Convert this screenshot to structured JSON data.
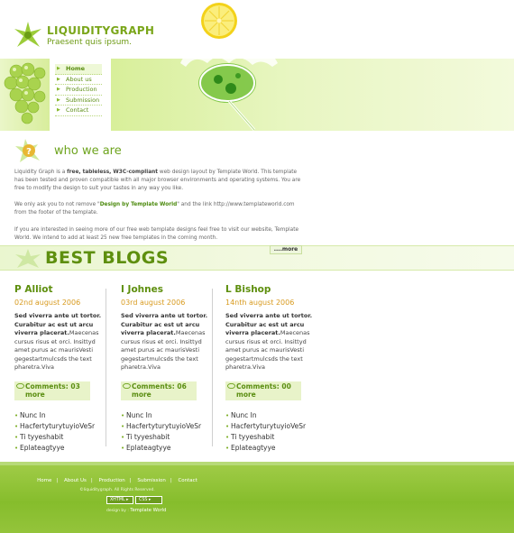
{
  "logo": {
    "name": "LIQUIDITYGRAPH",
    "tagline": "Praesent quis ipsum."
  },
  "nav": [
    {
      "label": "Home",
      "active": true
    },
    {
      "label": "About us",
      "active": false
    },
    {
      "label": "Production",
      "active": false
    },
    {
      "label": "Submission",
      "active": false
    },
    {
      "label": "Contact",
      "active": false
    }
  ],
  "who": {
    "title": "who we are",
    "p1_pre": "Liquidity Graph is a ",
    "p1_bold": "free, tableless, W3C-compliant",
    "p1_post": " web design layout by Template World. This template has been tested and proven compatible with all major browser environments and operating systems. You are free to modify the design to suit your tastes in any way you like.",
    "p2_pre": "We only ask you to not remove \"",
    "p2_link": "Design by Template World",
    "p2_post": "\" and the link http://www.templateworld.com from the footer of the template.",
    "p3": "If you are interested in seeing more of our free web template designs feel free to visit our website, Template World. We intend to add at least 25 new free templates in the coming month.",
    "more": "....more"
  },
  "blogs": {
    "title": "BEST BLOGS",
    "columns": [
      {
        "name": "P Alliot",
        "date": "02nd august 2006",
        "bio_bold": "Sed viverra ante ut tortor. Curabitur ac est ut arcu viverra placerat.",
        "bio": "Maecenas cursus risus et orci. Insittyd amet purus ac maurisVesti gegestartmulcsds the text pharetra.Viva",
        "comments": "Comments: 03",
        "more": "more",
        "items": [
          "Nunc In",
          "HacfertyturytuyioVeSr",
          "Ti tyyeshabit",
          "Eplateagtyye"
        ]
      },
      {
        "name": "I Johnes",
        "date": "03rd august 2006",
        "bio_bold": "Sed viverra ante ut tortor. Curabitur ac est ut arcu viverra placerat.",
        "bio": "Maecenas cursus risus et orci. Insittyd amet purus ac maurisVesti gegestartmulcsds the text pharetra.Viva",
        "comments": "Comments: 06",
        "more": "more",
        "items": [
          "Nunc In",
          "HacfertyturytuyioVeSr",
          "Ti tyyeshabit",
          "Eplateagtyye"
        ]
      },
      {
        "name": "L Bishop",
        "date": "14nth august 2006",
        "bio_bold": "Sed viverra ante ut tortor. Curabitur ac est ut arcu viverra placerat.",
        "bio": "Maecenas cursus risus et orci. Insittyd amet purus ac maurisVesti gegestartmulcsds the text pharetra.Viva",
        "comments": "Comments: 00",
        "more": "more",
        "items": [
          "Nunc In",
          "HacfertyturytuyioVeSr",
          "Ti tyyeshabit",
          "Eplateagtyye"
        ]
      }
    ]
  },
  "footer": {
    "links": [
      "Home",
      "About Us",
      "Production",
      "Submission",
      "Contact"
    ],
    "copyright": "©liquiditygraph. All Rights Reserved.",
    "badges": [
      "XHTML",
      "CSS"
    ],
    "design_label": "design by",
    "design_name": "Template World"
  },
  "colors": {
    "accent": "#6ea41e",
    "date": "#d89a1e",
    "footer": "#8fc13a",
    "light": "#e8f3c9"
  },
  "icons": {
    "logo": "star-splash-icon",
    "nav_arrow": "triangle-right-icon",
    "comment": "speech-bubble-icon",
    "bullet": "dot-icon"
  }
}
